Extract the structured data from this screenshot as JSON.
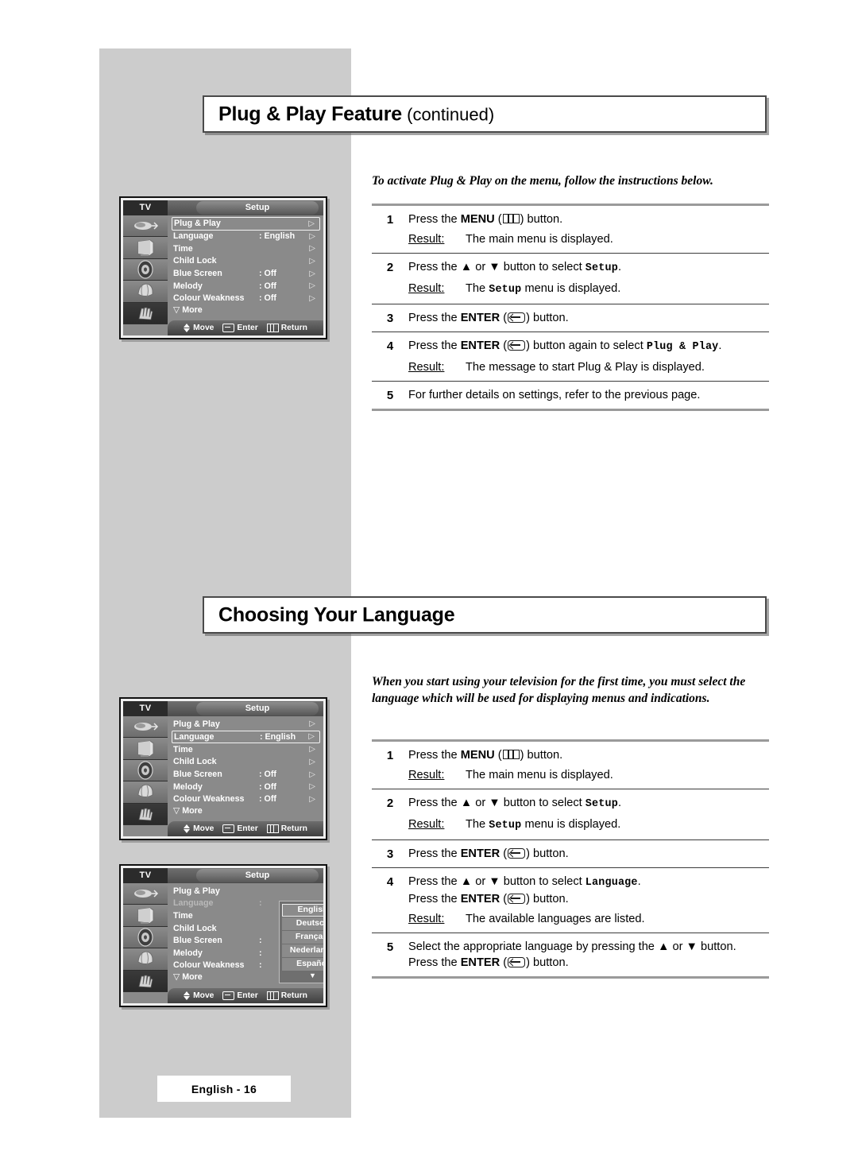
{
  "page": {
    "footer_label": "English - 16",
    "band_color": "#cccccc"
  },
  "sections": [
    {
      "heading_main": "Plug & Play Feature",
      "heading_sub": " (continued)",
      "intro": "To activate Plug & Play on the menu, follow the instructions below."
    },
    {
      "heading_main": "Choosing Your Language",
      "heading_sub": "",
      "intro": "When you start using your television for the first time, you must select the language which will be used for displaying menus and indications."
    }
  ],
  "steps_plugplay": [
    {
      "num": "1",
      "pre": "Press the ",
      "bold": "MENU",
      "icon": "menu-icon",
      "post": " button.",
      "result_label": "Result:",
      "result_text": "The main menu is displayed."
    },
    {
      "num": "2",
      "pre": "Press the ▲ or ▼ button to select ",
      "mono": "Setup",
      "post": ".",
      "result_label": "Result:",
      "result_pre": "The ",
      "result_mono": "Setup",
      "result_post": " menu is displayed."
    },
    {
      "num": "3",
      "pre": "Press the ",
      "bold": "ENTER",
      "icon": "enter-icon",
      "post": " button."
    },
    {
      "num": "4",
      "pre": "Press the ",
      "bold": "ENTER",
      "icon": "enter-icon",
      "post": " button again to select ",
      "mono": "Plug & Play",
      "tail": ".",
      "result_label": "Result:",
      "result_text": "The message to start Plug & Play is displayed."
    },
    {
      "num": "5",
      "pre": "For further details on settings, refer to the previous page."
    }
  ],
  "steps_language": [
    {
      "num": "1",
      "pre": "Press the ",
      "bold": "MENU",
      "icon": "menu-icon",
      "post": " button.",
      "result_label": "Result:",
      "result_text": "The main menu is displayed."
    },
    {
      "num": "2",
      "pre": "Press the ▲ or ▼ button to select ",
      "mono": "Setup",
      "post": ".",
      "result_label": "Result:",
      "result_pre": "The ",
      "result_mono": "Setup",
      "result_post": " menu is displayed."
    },
    {
      "num": "3",
      "pre": "Press the ",
      "bold": "ENTER",
      "icon": "enter-icon",
      "post": " button."
    },
    {
      "num": "4",
      "pre": "Press the ▲ or ▼ button to select ",
      "mono": "Language",
      "post": ".",
      "line2_pre": "Press the ",
      "line2_bold": "ENTER",
      "line2_icon": "enter-icon",
      "line2_post": " button.",
      "result_label": "Result:",
      "result_text": "The available languages are listed."
    },
    {
      "num": "5",
      "pre": "Select the appropriate language by pressing the ▲ or ▼ button.",
      "line2_pre": "Press the ",
      "line2_bold": "ENTER",
      "line2_icon": "enter-icon",
      "line2_post": " button."
    }
  ],
  "osd": {
    "tv_label": "TV",
    "title": "Setup",
    "sidebar_icons": [
      "antenna-icon",
      "picture-icon",
      "sound-icon",
      "channel-icon",
      "setup-hand-icon"
    ],
    "rows": [
      {
        "label": "Plug & Play",
        "value": "",
        "arrow": "▷"
      },
      {
        "label": "Language",
        "value": ": English",
        "arrow": "▷"
      },
      {
        "label": "Time",
        "value": "",
        "arrow": "▷"
      },
      {
        "label": "Child Lock",
        "value": "",
        "arrow": "▷"
      },
      {
        "label": "Blue Screen",
        "value": ": Off",
        "arrow": "▷"
      },
      {
        "label": "Melody",
        "value": ": Off",
        "arrow": "▷"
      },
      {
        "label": "Colour Weakness",
        "value": ": Off",
        "arrow": "▷"
      }
    ],
    "more_label": "▽ More",
    "bottom": {
      "move": "Move",
      "enter": "Enter",
      "return": "Return"
    },
    "highlight_1": "Plug & Play",
    "highlight_2": "Language",
    "languages": [
      "English",
      "Deutsch",
      "Français",
      "Nederlands",
      "Español"
    ],
    "language_selected": "English",
    "language_more": "▼"
  }
}
